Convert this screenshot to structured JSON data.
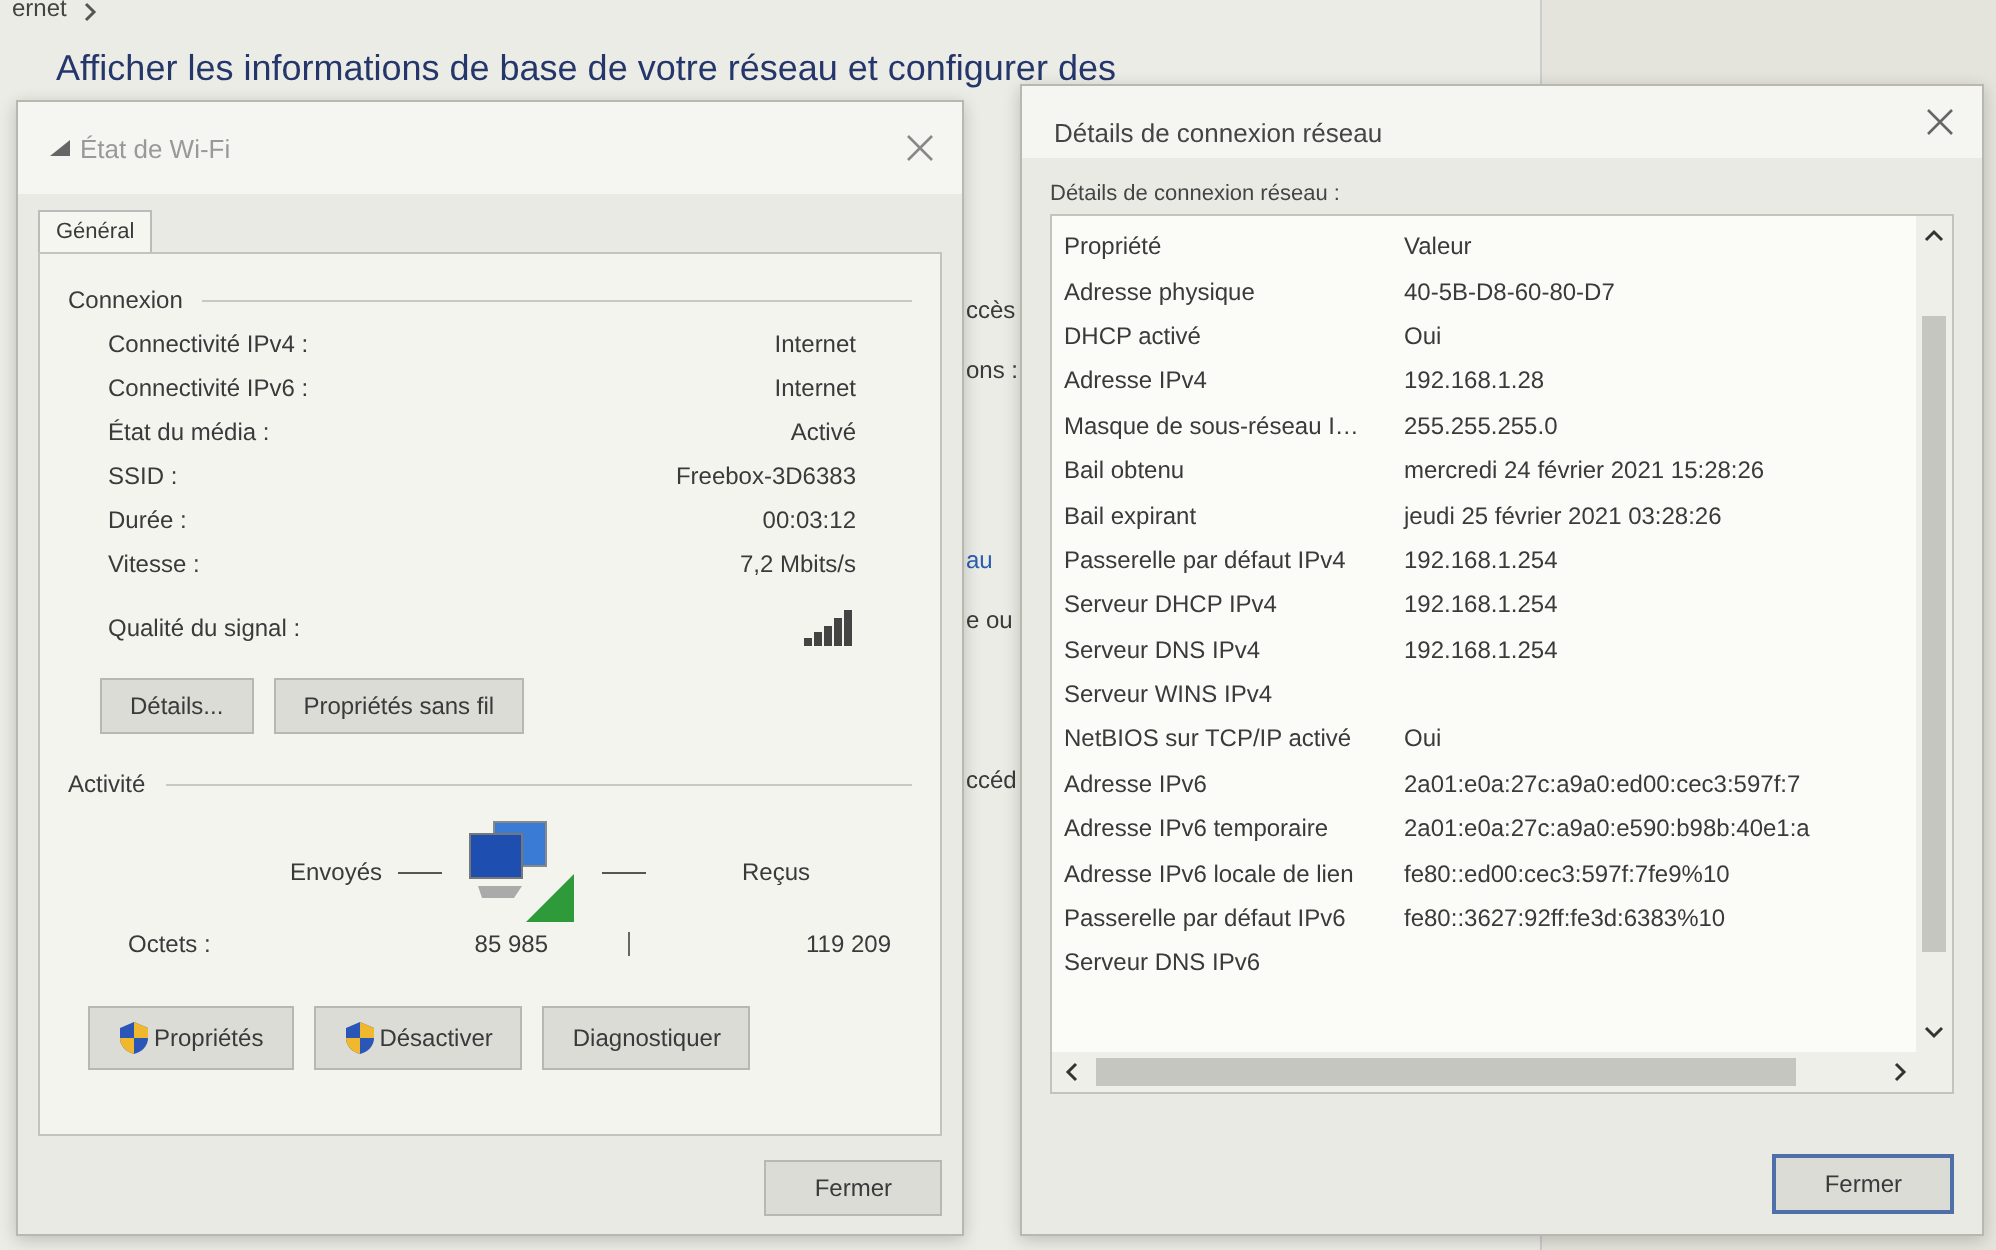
{
  "background": {
    "breadcrumb": "ernet",
    "heading": "Afficher les informations de base de votre réseau et configurer des",
    "fragments": [
      {
        "text": "ccès",
        "kind": "text"
      },
      {
        "text": "ons :",
        "kind": "text"
      },
      {
        "text": "au",
        "kind": "link"
      },
      {
        "text": "e ou",
        "kind": "text"
      },
      {
        "text": "ccéd",
        "kind": "text"
      }
    ]
  },
  "wifi_status": {
    "title": "État de Wi-Fi",
    "tabs": [
      {
        "label": "Général",
        "selected": true
      }
    ],
    "connection": {
      "heading": "Connexion",
      "rows": [
        {
          "label": "Connectivité IPv4 :",
          "value": "Internet"
        },
        {
          "label": "Connectivité IPv6 :",
          "value": "Internet"
        },
        {
          "label": "État du média :",
          "value": "Activé"
        },
        {
          "label": "SSID :",
          "value": "Freebox-3D6383"
        },
        {
          "label": "Durée :",
          "value": "00:03:12"
        },
        {
          "label": "Vitesse :",
          "value": "7,2 Mbits/s"
        }
      ],
      "signal_label": "Qualité du signal :"
    },
    "connection_buttons": [
      "Détails...",
      "Propriétés sans fil"
    ],
    "activity": {
      "heading": "Activité",
      "sent_label": "Envoyés",
      "received_label": "Reçus",
      "bytes_label": "Octets :",
      "bytes_sent": "85 985",
      "bytes_received": "119 209"
    },
    "action_buttons": [
      {
        "label": "Propriétés",
        "shield": true
      },
      {
        "label": "Désactiver",
        "shield": true
      },
      {
        "label": "Diagnostiquer",
        "shield": false
      }
    ],
    "close_button": "Fermer"
  },
  "details": {
    "title": "Détails de connexion réseau",
    "list_label": "Détails de connexion réseau :",
    "columns": [
      "Propriété",
      "Valeur"
    ],
    "rows": [
      [
        "Adresse physique",
        "40-5B-D8-60-80-D7"
      ],
      [
        "DHCP activé",
        "Oui"
      ],
      [
        "Adresse IPv4",
        "192.168.1.28"
      ],
      [
        "Masque de sous-réseau I…",
        "255.255.255.0"
      ],
      [
        "Bail obtenu",
        "mercredi 24 février 2021 15:28:26"
      ],
      [
        "Bail expirant",
        "jeudi 25 février 2021 03:28:26"
      ],
      [
        "Passerelle par défaut IPv4",
        "192.168.1.254"
      ],
      [
        "Serveur DHCP IPv4",
        "192.168.1.254"
      ],
      [
        "Serveur DNS IPv4",
        "192.168.1.254"
      ],
      [
        "Serveur WINS IPv4",
        ""
      ],
      [
        "NetBIOS sur TCP/IP activé",
        "Oui"
      ],
      [
        "Adresse IPv6",
        "2a01:e0a:27c:a9a0:ed00:cec3:597f:7"
      ],
      [
        "Adresse IPv6 temporaire",
        "2a01:e0a:27c:a9a0:e590:b98b:40e1:a"
      ],
      [
        "Adresse IPv6 locale de lien",
        "fe80::ed00:cec3:597f:7fe9%10"
      ],
      [
        "Passerelle par défaut IPv6",
        "fe80::3627:92ff:fe3d:6383%10"
      ],
      [
        "Serveur DNS IPv6",
        ""
      ]
    ],
    "close_button": "Fermer"
  }
}
